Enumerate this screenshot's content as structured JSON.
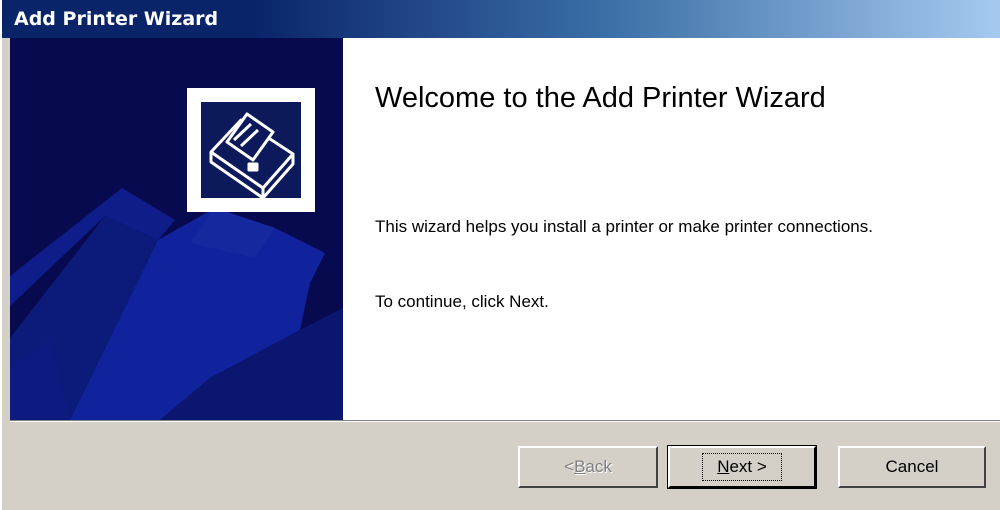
{
  "window": {
    "title": "Add Printer Wizard"
  },
  "sidebar": {
    "icon": "printer-icon",
    "background_color": "#070a4e"
  },
  "main": {
    "heading": "Welcome to the Add Printer Wizard",
    "description": "This wizard helps you install a printer or make printer connections.",
    "instruction": "To continue, click Next."
  },
  "buttons": {
    "back": {
      "prefix": "< ",
      "mnemonic": "B",
      "rest": "ack",
      "enabled": false
    },
    "next": {
      "mnemonic": "N",
      "rest": "ext >",
      "enabled": true
    },
    "cancel": {
      "label": "Cancel",
      "enabled": true
    }
  },
  "colors": {
    "title_start": "#0a246a",
    "title_end": "#a6caf0",
    "face": "#d4d0c8"
  }
}
